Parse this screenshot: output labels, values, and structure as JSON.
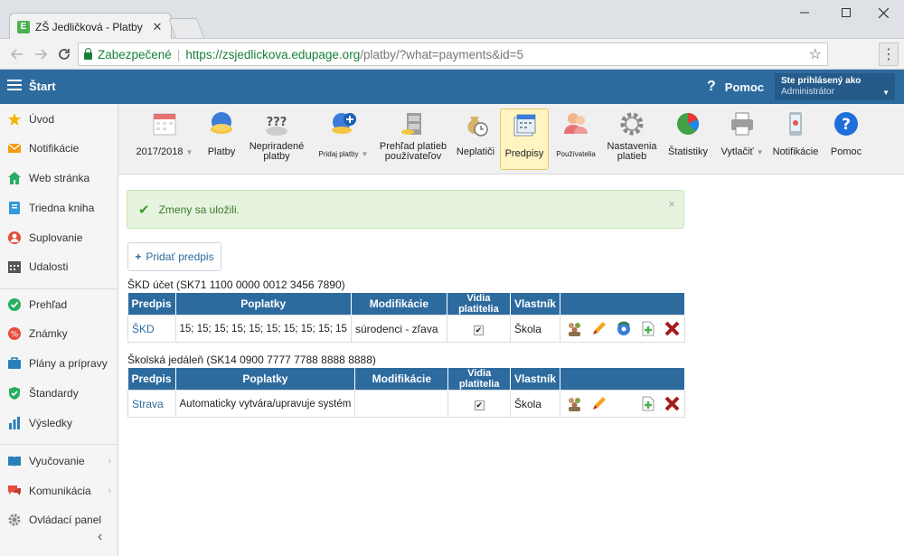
{
  "browser": {
    "tab_title": "ZŠ Jedličková - Platby",
    "tab_close": "✕",
    "secure_label": "Zabezpečené",
    "url_scheme_host": "https://zsjedlickova.edupage.org",
    "url_path": "/platby/?what=payments&id=5"
  },
  "header": {
    "start_label": "Štart",
    "help_label": "Pomoc",
    "logged_as_label": "Ste prihlásený ako",
    "role": "Administrátor"
  },
  "sidebar": {
    "items": [
      {
        "label": "Úvod",
        "icon": "star-icon"
      },
      {
        "label": "Notifikácie",
        "icon": "envelope-icon"
      },
      {
        "label": "Web stránka",
        "icon": "home-icon"
      },
      {
        "label": "Triedna kniha",
        "icon": "book-icon"
      },
      {
        "label": "Suplovanie",
        "icon": "person-swap-icon"
      },
      {
        "label": "Udalosti",
        "icon": "calendar-icon"
      },
      {
        "label": "Prehľad",
        "icon": "check-circle-icon"
      },
      {
        "label": "Známky",
        "icon": "grades-icon"
      },
      {
        "label": "Plány a prípravy",
        "icon": "briefcase-icon"
      },
      {
        "label": "Štandardy",
        "icon": "shield-check-icon"
      },
      {
        "label": "Výsledky",
        "icon": "bar-chart-icon"
      },
      {
        "label": "Vyučovanie",
        "icon": "open-book-icon"
      },
      {
        "label": "Komunikácia",
        "icon": "chat-icon"
      },
      {
        "label": "Ovládací panel",
        "icon": "gear-icon"
      }
    ]
  },
  "toolbar": {
    "year": "2017/2018",
    "payments": "Platby",
    "unassigned_l1": "Nepriradené",
    "unassigned_l2": "platby",
    "add_payments": "Pridaj platby",
    "overview_l1": "Prehľad platieb",
    "overview_l2": "používateľov",
    "debtors": "Neplatiči",
    "regulations": "Predpisy",
    "users": "Používatelia",
    "settings_l1": "Nastavenia",
    "settings_l2": "platieb",
    "stats": "Štatistiky",
    "print": "Vytlačiť",
    "notifications": "Notifikácie",
    "help": "Pomoc"
  },
  "alert": {
    "message": "Zmeny sa uložili.",
    "close": "×"
  },
  "add_button": "Pridať predpis",
  "table_headers": {
    "predpis": "Predpis",
    "poplatky": "Poplatky",
    "modifikacie": "Modifikácie",
    "vidia": "Vidia platitelia",
    "vlastnik": "Vlastník"
  },
  "tables": [
    {
      "caption": "ŠKD účet (SK71 1100 0000 0012 3456 7890)",
      "row": {
        "predpis": "ŠKD",
        "poplatky": "15; 15; 15; 15; 15; 15; 15; 15; 15; 15",
        "modifikacie": "súrodenci - zľava",
        "vidia": "✔",
        "vlastnik": "Škola"
      }
    },
    {
      "caption": "Školská jedáleň (SK14 0900 7777 7788 8888 8888)",
      "row": {
        "predpis": "Strava",
        "poplatky": "Automaticky vytvára/upravuje systém",
        "modifikacie": "",
        "vidia": "✔",
        "vlastnik": "Škola"
      }
    }
  ]
}
